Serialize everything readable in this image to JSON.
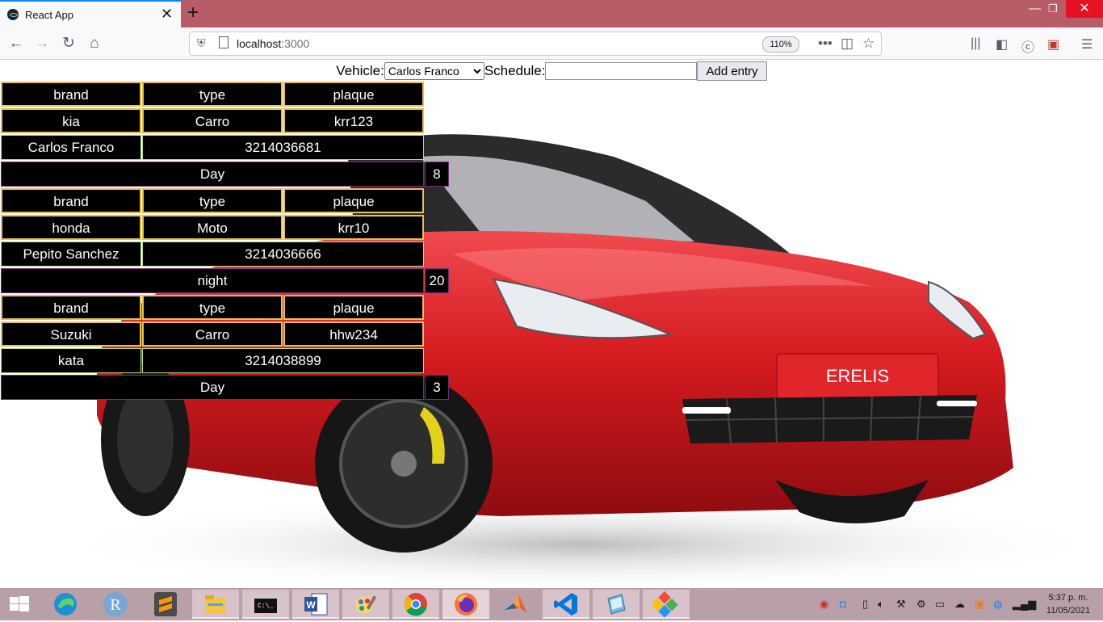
{
  "browser": {
    "tab_title": "React App",
    "url_host": "localhost",
    "url_port": ":3000",
    "zoom": "110%"
  },
  "form": {
    "vehicle_label": "Vehicle:",
    "vehicle_selected": "Carlos Franco",
    "schedule_label": "Schedule:",
    "schedule_value": "",
    "add_button": "Add entry"
  },
  "records": [
    {
      "headers": [
        "brand",
        "type",
        "plaque"
      ],
      "brand": "kia",
      "type": "Carro",
      "plaque": "krr123",
      "owner": "Carlos Franco",
      "phone": "3214036681",
      "shift": "Day",
      "hours": "8"
    },
    {
      "headers": [
        "brand",
        "type",
        "plaque"
      ],
      "brand": "honda",
      "type": "Moto",
      "plaque": "krr10",
      "owner": "Pepito Sanchez",
      "phone": "3214036666",
      "shift": "night",
      "hours": "20"
    },
    {
      "headers": [
        "brand",
        "type",
        "plaque"
      ],
      "brand": "Suzuki",
      "type": "Carro",
      "plaque": "hhw234",
      "owner": "kata",
      "phone": "3214038899",
      "shift": "Day",
      "hours": "3"
    }
  ],
  "background_image": {
    "plate_text": "ERELIS"
  },
  "taskbar": {
    "clock_time": "5:37 p. m.",
    "clock_date": "11/05/2021",
    "r_app_letter": "R"
  },
  "colors": {
    "tabbar": "#b85c68",
    "taskbar": "#b9a0a8",
    "cell_bg": "#000000",
    "header_border": "#e5c04a",
    "owner_border": "#b9d97f",
    "schedule_border": "#7d2b7a",
    "car_red": "#d41a1f"
  }
}
